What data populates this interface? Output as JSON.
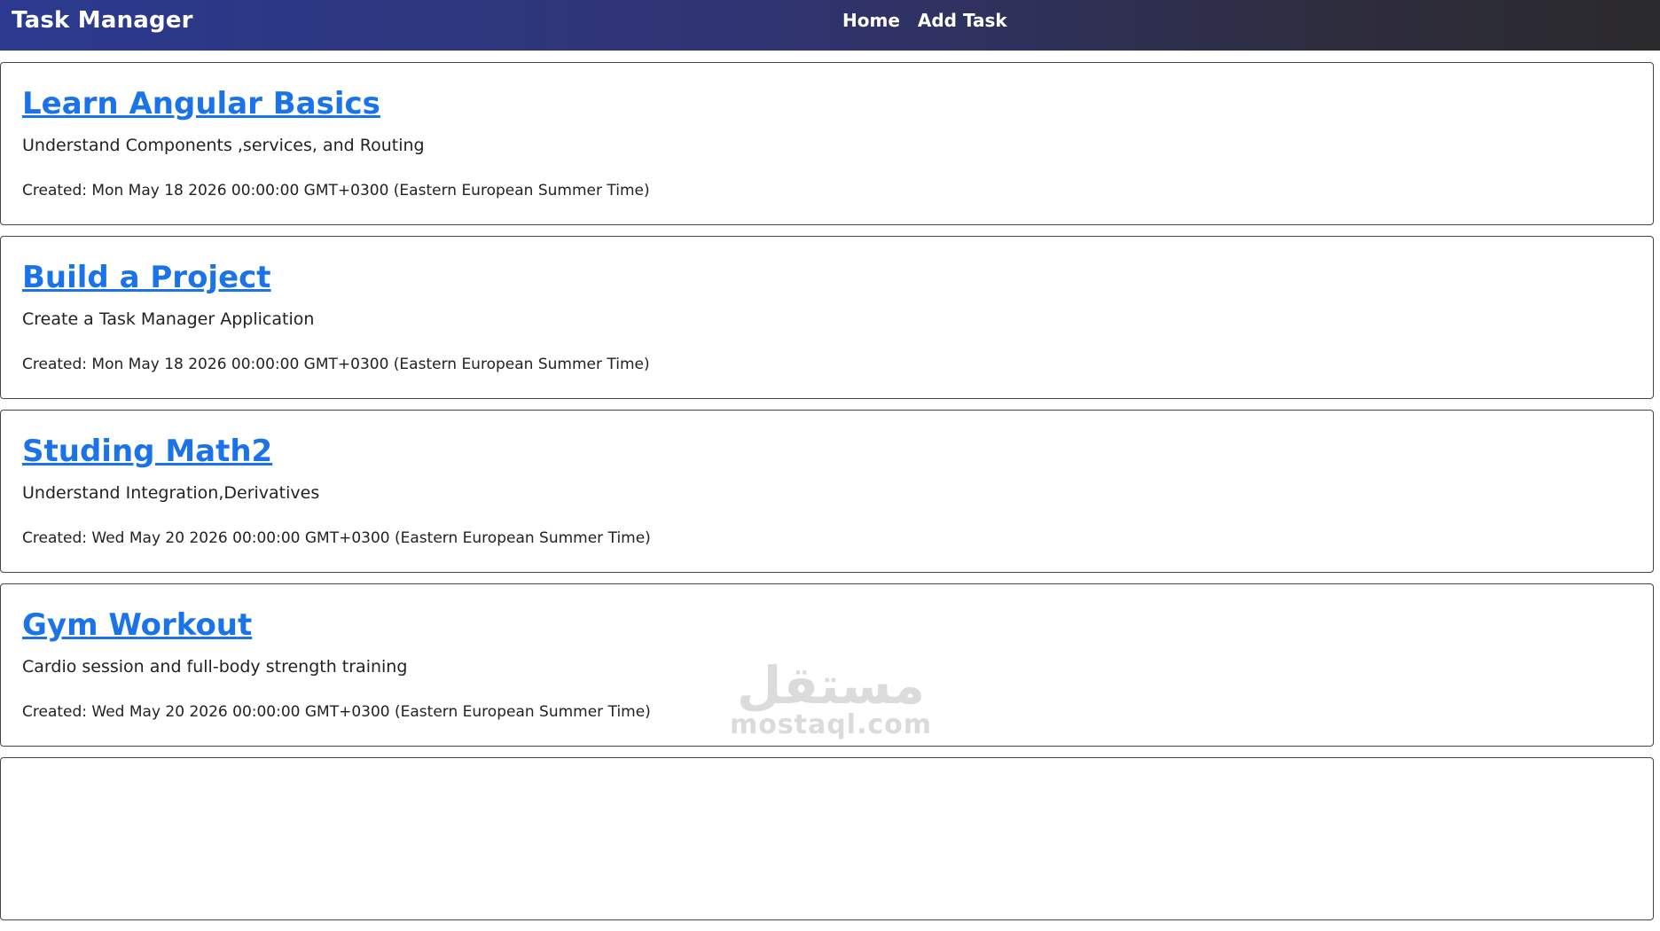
{
  "header": {
    "brand": "Task Manager",
    "nav": [
      {
        "label": "Home"
      },
      {
        "label": "Add Task"
      }
    ]
  },
  "tasks": [
    {
      "title": "Learn Angular Basics",
      "description": "Understand Components ,services, and Routing",
      "created": "Created: Mon May 18 2026 00:00:00 GMT+0300 (Eastern European Summer Time)"
    },
    {
      "title": "Build a Project",
      "description": "Create a Task Manager Application",
      "created": "Created: Mon May 18 2026 00:00:00 GMT+0300 (Eastern European Summer Time)"
    },
    {
      "title": "Studing Math2",
      "description": "Understand Integration,Derivatives",
      "created": "Created: Wed May 20 2026 00:00:00 GMT+0300 (Eastern European Summer Time)"
    },
    {
      "title": "Gym Workout",
      "description": "Cardio session and full-body strength training",
      "created": "Created: Wed May 20 2026 00:00:00 GMT+0300 (Eastern European Summer Time)"
    }
  ],
  "watermark": {
    "arabic": "مستقل",
    "latin": "mostaql.com"
  },
  "colors": {
    "title_link": "#1a73e8",
    "navbar_start": "#2b3a8f",
    "navbar_end": "#2b2a2c"
  }
}
